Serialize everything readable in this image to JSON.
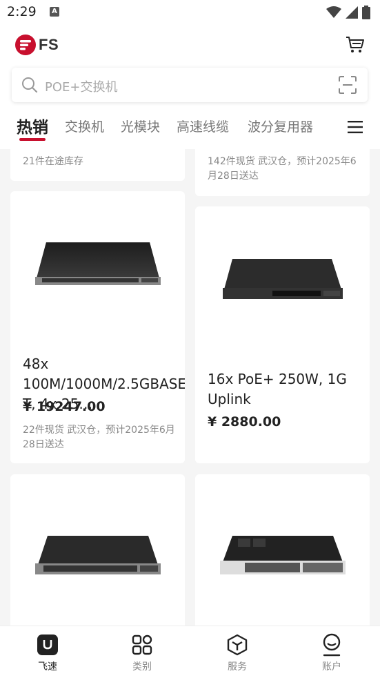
{
  "status": {
    "time": "2:29",
    "notif_letter": "A"
  },
  "header": {
    "logo_text": "FS",
    "search_placeholder": "POE+交换机"
  },
  "tabs": [
    {
      "label": "热销",
      "active": true
    },
    {
      "label": "交换机",
      "active": false
    },
    {
      "label": "光模块",
      "active": false
    },
    {
      "label": "高速线缆",
      "active": false
    },
    {
      "label": "波分复用器",
      "active": false
    }
  ],
  "products": [
    {
      "stock": "21件在途库存"
    },
    {
      "stock": "142件现货 武汉仓，预计2025年6月28日送达"
    },
    {
      "title": "48x 100M/1000M/2.5GBASE-T,  4x 25…",
      "price": "¥ 19247.00",
      "stock": "22件现货 武汉仓，预计2025年6月28日送达"
    },
    {
      "title": "16x PoE+ 250W, 1G Uplink",
      "price": "¥ 2880.00"
    }
  ],
  "bottom_nav": [
    {
      "label": "飞速",
      "icon": "home-icon",
      "active": true
    },
    {
      "label": "类别",
      "icon": "category-icon",
      "active": false
    },
    {
      "label": "服务",
      "icon": "service-icon",
      "active": false
    },
    {
      "label": "账户",
      "icon": "account-icon",
      "active": false
    }
  ],
  "colors": {
    "brand": "#c8102e",
    "text": "#222222",
    "muted": "#888888"
  }
}
